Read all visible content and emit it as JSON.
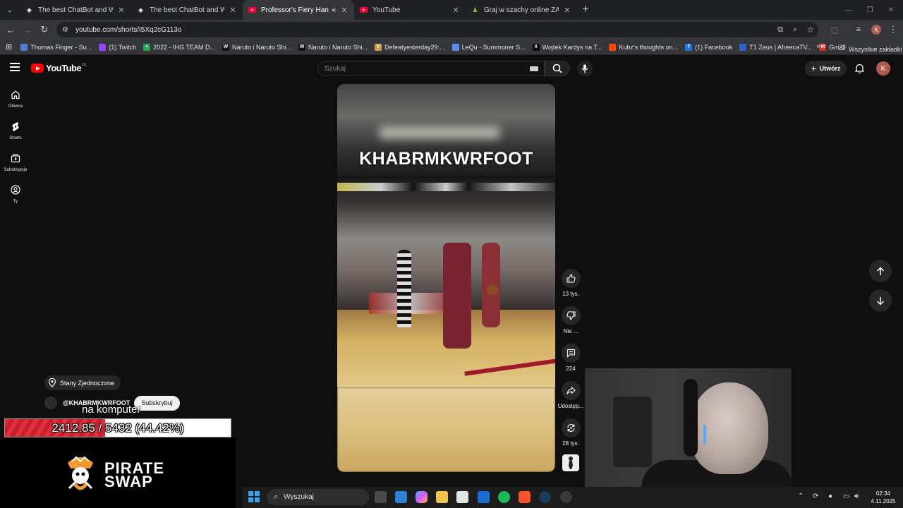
{
  "browser": {
    "tabs": [
      {
        "title": "The best ChatBot and Widgets",
        "active": false
      },
      {
        "title": "The best ChatBot and Widgets",
        "active": false
      },
      {
        "title": "Professor's Fiery Handles -",
        "active": true
      },
      {
        "title": "YouTube",
        "active": false
      },
      {
        "title": "Graj w szachy online ZA DARMO",
        "active": false
      }
    ],
    "url": "youtube.com/shorts/I5Xq2cG113o",
    "bookmarks": [
      {
        "label": "Thomas Finger - Su...",
        "color": "#4c7bd9",
        "glyph": ""
      },
      {
        "label": "(1) Twitch",
        "color": "#9146ff",
        "glyph": ""
      },
      {
        "label": "2022 - IHG TEAM D...",
        "color": "#23a455",
        "glyph": "+"
      },
      {
        "label": "Naruto i Naruto Shi...",
        "color": "#111111",
        "glyph": "W"
      },
      {
        "label": "Naruto i Naruto Shi...",
        "color": "#111111",
        "glyph": "W"
      },
      {
        "label": "Defeatyesterday29:...",
        "color": "#c8a04a",
        "glyph": "V"
      },
      {
        "label": "LeQu - Summoner S...",
        "color": "#5b8def",
        "glyph": ""
      },
      {
        "label": "Wojtek Kardys na T...",
        "color": "#000000",
        "glyph": "X"
      },
      {
        "label": "Kubz's thoughts on...",
        "color": "#ff4500",
        "glyph": ""
      },
      {
        "label": "(1) Facebook",
        "color": "#1877f2",
        "glyph": "f"
      },
      {
        "label": "T1 Zeus | AfreecaTV...",
        "color": "#2a66c9",
        "glyph": ""
      },
      {
        "label": "Gmail",
        "color": "#d93025",
        "glyph": "M"
      }
    ],
    "all_bookmarks": "Wszystkie zakładki"
  },
  "youtube": {
    "logo": "YouTube",
    "region": "PL",
    "search_placeholder": "Szukaj",
    "create_label": "Utwórz",
    "avatar_letter": "K",
    "sidebar": [
      {
        "label": "Główna",
        "icon": "home-icon"
      },
      {
        "label": "Shorts",
        "icon": "shorts-icon"
      },
      {
        "label": "Subskrypcje",
        "icon": "subscriptions-icon"
      },
      {
        "label": "Ty",
        "icon": "you-icon"
      }
    ],
    "video_title_overlay": "KHABRMKWRFOOT",
    "actions": [
      {
        "label": "13 tys.",
        "icon": "like-icon"
      },
      {
        "label": "Nie ...",
        "icon": "dislike-icon"
      },
      {
        "label": "224",
        "icon": "comments-icon"
      },
      {
        "label": "Udostęp...",
        "icon": "share-icon"
      },
      {
        "label": "28 tys.",
        "icon": "remix-icon"
      }
    ],
    "location": "Stany Zjednoczone",
    "channel": "@KHABRMKWRFOOT",
    "subscribe_label": "Subskrybuj"
  },
  "stream_overlay": {
    "subtitle": "na komputer",
    "goal_text": "2412.85 / 5432 (44.42%)",
    "goal_fraction": 0.4442,
    "sponsor_line1": "PIRATE",
    "sponsor_line2": "SWAP"
  },
  "taskbar": {
    "search_label": "Wyszukaj",
    "time": "02:34",
    "date": "4.11.2025"
  }
}
